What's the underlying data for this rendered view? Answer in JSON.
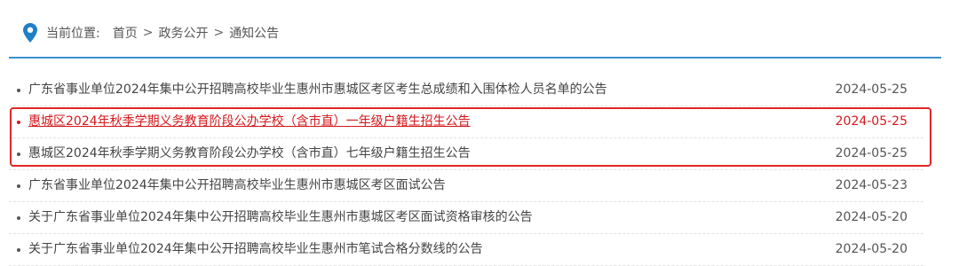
{
  "breadcrumb": {
    "label": "当前位置:",
    "items": [
      "首页",
      "政务公开",
      "通知公告"
    ],
    "separator": ">"
  },
  "colors": {
    "accent": "#3b8fce",
    "active": "#d4171b",
    "highlight_border": "#e02727"
  },
  "icons": {
    "location": "map-pin-icon"
  },
  "notices": [
    {
      "title": "广东省事业单位2024年集中公开招聘高校毕业生惠州市惠城区考区考生总成绩和入围体检人员名单的公告",
      "date": "2024-05-25"
    },
    {
      "title": "惠城区2024年秋季学期义务教育阶段公办学校（含市直）一年级户籍生招生公告",
      "date": "2024-05-25"
    },
    {
      "title": "惠城区2024年秋季学期义务教育阶段公办学校（含市直）七年级户籍生招生公告",
      "date": "2024-05-25"
    },
    {
      "title": "广东省事业单位2024年集中公开招聘高校毕业生惠州市惠城区考区面试公告",
      "date": "2024-05-23"
    },
    {
      "title": "关于广东省事业单位2024年集中公开招聘高校毕业生惠州市惠城区考区面试资格审核的公告",
      "date": "2024-05-20"
    },
    {
      "title": "关于广东省事业单位2024年集中公开招聘高校毕业生惠州市笔试合格分数线的公告",
      "date": "2024-05-20"
    }
  ]
}
